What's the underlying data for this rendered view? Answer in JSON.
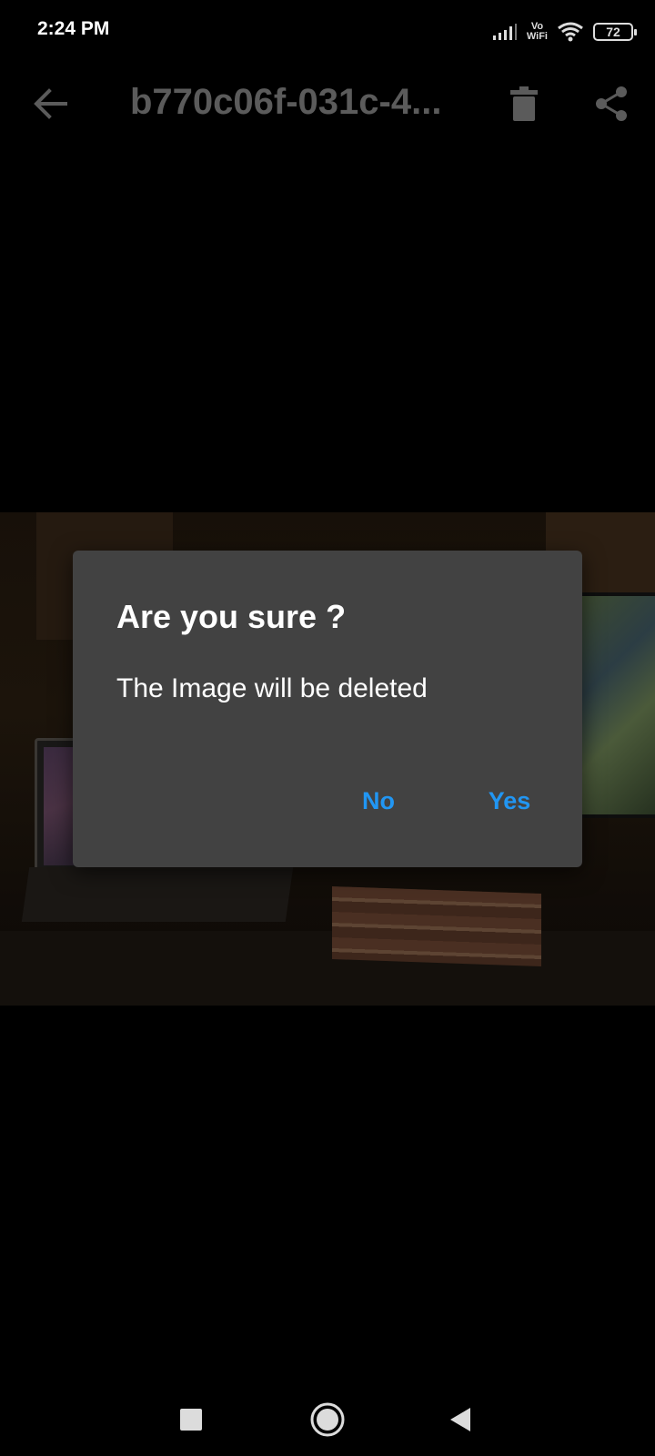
{
  "status_bar": {
    "time": "2:24 PM",
    "vowifi_top": "Vo",
    "vowifi_bottom": "WiFi",
    "battery": "72",
    "icons": [
      "signal-icon",
      "vowifi-icon",
      "wifi-icon",
      "battery-icon"
    ]
  },
  "app_bar": {
    "title": "b770c06f-031c-4...",
    "icons": [
      "back-arrow-icon",
      "trash-icon",
      "share-icon"
    ]
  },
  "dialog": {
    "title": "Are you sure ?",
    "message": "The Image will be deleted",
    "no_label": "No",
    "yes_label": "Yes"
  },
  "colors": {
    "background": "#000000",
    "dialog_bg": "#424242",
    "accent": "#2196f3",
    "app_bar_text": "#5b5b5b"
  },
  "nav_bar": {
    "icons": [
      "recents-square-icon",
      "home-circle-icon",
      "back-triangle-icon"
    ]
  }
}
